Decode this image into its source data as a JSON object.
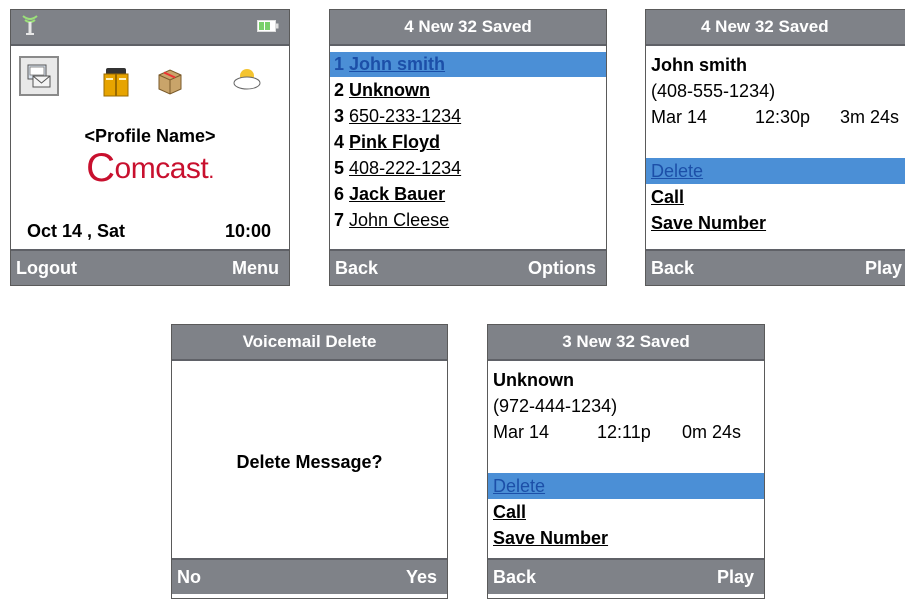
{
  "home": {
    "date": "Oct 14 , Sat",
    "time": "10:00",
    "profile": "<Profile Name>",
    "brand_c": "C",
    "brand_rest": "omcast",
    "brand_dot": ".",
    "softkey_left": "Logout",
    "softkey_right": "Menu"
  },
  "list_screen": {
    "title": "4 New 32 Saved",
    "items": [
      {
        "num": "1",
        "name": "John smith"
      },
      {
        "num": "2",
        "name": "Unknown"
      },
      {
        "num": "3",
        "name": "650-233-1234"
      },
      {
        "num": "4",
        "name": "Pink Floyd"
      },
      {
        "num": "5",
        "name": "408-222-1234"
      },
      {
        "num": "6",
        "name": "Jack Bauer"
      },
      {
        "num": "7",
        "name": "John Cleese"
      }
    ],
    "softkey_left": "Back",
    "softkey_right": "Options"
  },
  "detail1": {
    "title": "4 New 32 Saved",
    "name": "John smith",
    "number": "(408-555-1234)",
    "date": "Mar 14",
    "time": "12:30p",
    "duration": "3m 24s",
    "options": [
      "Delete",
      "Call",
      "Save Number"
    ],
    "softkey_left": "Back",
    "softkey_right": "Play"
  },
  "confirm": {
    "title": "Voicemail Delete",
    "message": "Delete Message?",
    "softkey_left": "No",
    "softkey_right": "Yes"
  },
  "detail2": {
    "title": "3 New 32 Saved",
    "name": "Unknown",
    "number": "(972-444-1234)",
    "date": "Mar 14",
    "time": "12:11p",
    "duration": "0m 24s",
    "options": [
      "Delete",
      "Call",
      "Save Number"
    ],
    "softkey_left": "Back",
    "softkey_right": "Play"
  },
  "colors": {
    "bar": "#7f8288",
    "selection": "#4b8fd6",
    "brand_red": "#c8102e"
  },
  "icons": [
    "signal-icon",
    "battery-icon",
    "voicemail-icon",
    "directory-icon",
    "box-icon",
    "weather-icon"
  ]
}
